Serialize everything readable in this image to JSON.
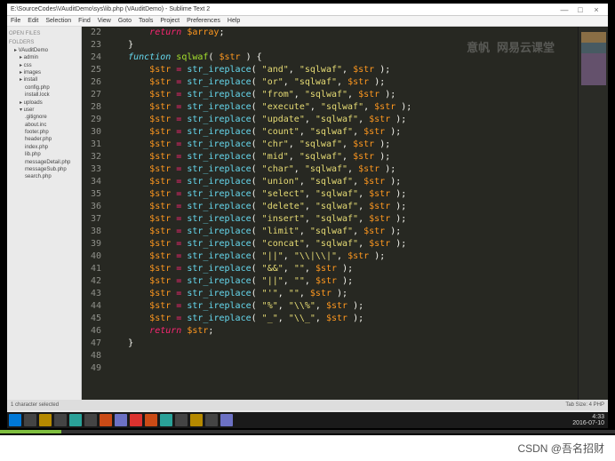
{
  "window": {
    "title": "E:\\SourceCodes\\VAuditDemo\\sys\\lib.php (VAuditDemo) - Sublime Text 2"
  },
  "menu": [
    "File",
    "Edit",
    "Selection",
    "Find",
    "View",
    "Goto",
    "Tools",
    "Project",
    "Preferences",
    "Help"
  ],
  "sidebar": {
    "header1": "OPEN FILES",
    "header2": "FOLDERS",
    "root": "VAuditDemo",
    "items": [
      "admin",
      "css",
      "images",
      "install"
    ],
    "files1": [
      "config.php",
      "install.lock"
    ],
    "folder2": "uploads",
    "folder3": "user",
    "files2": [
      ".gitignore",
      "about.inc",
      "footer.php",
      "header.php",
      "index.php",
      "lib.php",
      "messageDetail.php",
      "messageSub.php",
      "search.php"
    ]
  },
  "code": {
    "lines": [
      {
        "n": 22,
        "ind": 2,
        "t": "return_array"
      },
      {
        "n": 23,
        "ind": 1,
        "t": "close"
      },
      {
        "n": 24,
        "ind": 0,
        "t": "blank"
      },
      {
        "n": 25,
        "ind": 1,
        "t": "funcdecl"
      },
      {
        "n": 26,
        "ind": 2,
        "a": "\"and\"",
        "b": "\"sqlwaf\""
      },
      {
        "n": 27,
        "ind": 2,
        "a": "\"or\"",
        "b": "\"sqlwaf\""
      },
      {
        "n": 28,
        "ind": 2,
        "a": "\"from\"",
        "b": "\"sqlwaf\""
      },
      {
        "n": 29,
        "ind": 2,
        "a": "\"execute\"",
        "b": "\"sqlwaf\""
      },
      {
        "n": 30,
        "ind": 2,
        "a": "\"update\"",
        "b": "\"sqlwaf\""
      },
      {
        "n": 31,
        "ind": 2,
        "a": "\"count\"",
        "b": "\"sqlwaf\""
      },
      {
        "n": 32,
        "ind": 2,
        "a": "\"chr\"",
        "b": "\"sqlwaf\""
      },
      {
        "n": 33,
        "ind": 2,
        "a": "\"mid\"",
        "b": "\"sqlwaf\""
      },
      {
        "n": 34,
        "ind": 2,
        "a": "\"char\"",
        "b": "\"sqlwaf\""
      },
      {
        "n": 35,
        "ind": 2,
        "a": "\"union\"",
        "b": "\"sqlwaf\""
      },
      {
        "n": 36,
        "ind": 2,
        "a": "\"select\"",
        "b": "\"sqlwaf\""
      },
      {
        "n": 37,
        "ind": 2,
        "a": "\"delete\"",
        "b": "\"sqlwaf\""
      },
      {
        "n": 38,
        "ind": 2,
        "a": "\"insert\"",
        "b": "\"sqlwaf\""
      },
      {
        "n": 39,
        "ind": 2,
        "a": "\"limit\"",
        "b": "\"sqlwaf\""
      },
      {
        "n": 40,
        "ind": 2,
        "a": "\"concat\"",
        "b": "\"sqlwaf\""
      },
      {
        "n": 41,
        "ind": 2,
        "a": "\"||\"",
        "b": "\"\\\\|\\\\|\""
      },
      {
        "n": 42,
        "ind": 2,
        "a": "\"&&\"",
        "b": "\"\"",
        "short": true
      },
      {
        "n": 43,
        "ind": 2,
        "a": "\"||\"",
        "b": "\"\"",
        "short": true
      },
      {
        "n": 44,
        "ind": 2,
        "a": "\"'\"",
        "b": "\"\"",
        "short": true
      },
      {
        "n": 45,
        "ind": 2,
        "a": "\"%\"",
        "b": "\"\\\\%\"",
        "short": true
      },
      {
        "n": 46,
        "ind": 2,
        "a": "\"_\"",
        "b": "\"\\\\_\"",
        "short": true
      },
      {
        "n": 47,
        "ind": 2,
        "t": "return_str"
      },
      {
        "n": 48,
        "ind": 1,
        "t": "close"
      },
      {
        "n": 49,
        "ind": 0,
        "t": "blank"
      }
    ]
  },
  "status": {
    "left": "1 character selected",
    "right": "Tab Size: 4    PHP"
  },
  "watermark": "意帆    网易云课堂",
  "clock": {
    "time": "4:33",
    "date": "2016-07-10"
  },
  "footer": "CSDN @吾名招财"
}
